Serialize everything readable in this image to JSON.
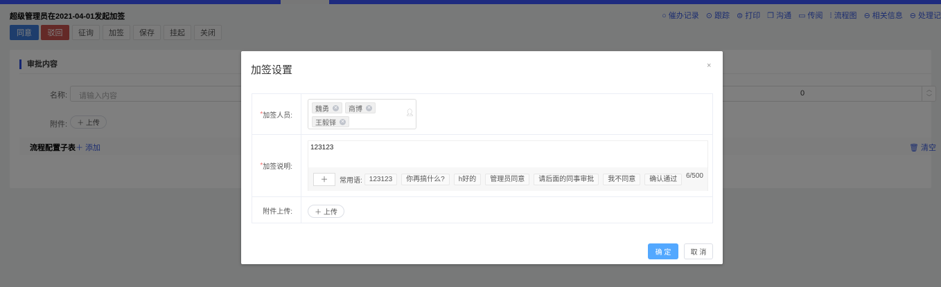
{
  "page": {
    "title": "超级管理员在2021-04-01发起加签",
    "buttons": [
      "同意",
      "驳回",
      "征询",
      "加签",
      "保存",
      "挂起",
      "关闭"
    ],
    "actions": [
      {
        "icon": "search-icon",
        "glyph": "○",
        "label": "催办记录"
      },
      {
        "icon": "track-icon",
        "glyph": "⊙",
        "label": "跟踪"
      },
      {
        "icon": "print-icon",
        "glyph": "⊜",
        "label": "打印"
      },
      {
        "icon": "chat-icon",
        "glyph": "❐",
        "label": "沟通"
      },
      {
        "icon": "folder-icon",
        "glyph": "▭",
        "label": "传阅"
      },
      {
        "icon": "flowchart-icon",
        "glyph": "⁞",
        "label": "流程图"
      },
      {
        "icon": "info-icon",
        "glyph": "⊖",
        "label": "相关信息"
      },
      {
        "icon": "record-icon",
        "glyph": "⊖",
        "label": "处理记"
      }
    ],
    "section_title": "审批内容",
    "name_label": "名称:",
    "name_placeholder": "请输入内容",
    "number_value": "0",
    "attach_label": "附件:",
    "upload_label": "＋ 上传",
    "subtable_title": "流程配置子表",
    "add_label": "＋ 添加",
    "clear_label": "清空"
  },
  "dialog": {
    "title": "加签设置",
    "close": "×",
    "people_label": "加签人员:",
    "people": [
      "魏勇",
      "商博",
      "王毅铎"
    ],
    "desc_label": "加签说明:",
    "desc_value": "123123",
    "add_phrase": "＋",
    "phrases_label": "常用语:",
    "phrases": [
      "123123",
      "你再搞什么?",
      "h好的",
      "管理员同意",
      "请后面的同事审批",
      "我不同意",
      "确认通过"
    ],
    "counter": "6/500",
    "attach_label": "附件上传:",
    "upload_label": "＋ 上传",
    "ok": "确 定",
    "cancel": "取 消"
  },
  "colors": {
    "primary": "#3c7bd9",
    "danger": "#c9534f",
    "ok": "#53a8ff"
  }
}
